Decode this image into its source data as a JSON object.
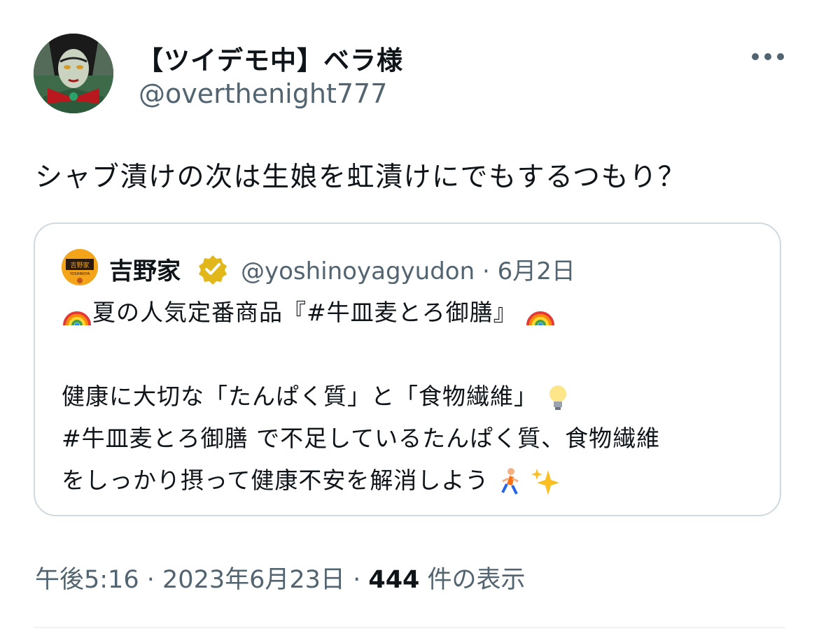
{
  "author": {
    "display_name": "【ツイデモ中】ベラ様",
    "handle": "@overthenight777"
  },
  "tweet_text": "シャブ漬けの次は生娘を虹漬けにでもするつもり？",
  "quoted": {
    "name": "吉野家",
    "handle": "@yoshinoyagyudon",
    "date": "6月2日",
    "line1": "夏の人気定番商品『#牛皿麦とろ御膳』",
    "line2": "健康に大切な「たんぱく質」と「食物繊維」",
    "line3": "#牛皿麦とろ御膳 で不足しているたんぱく質、食物繊維",
    "line4": "をしっかり摂って健康不安を解消しよう",
    "logo_text": "吉野家",
    "logo_sub": "YOSHINOYA",
    "icons": [
      "rainbow-icon",
      "lightbulb-icon",
      "runner-icon",
      "sparkles-icon",
      "verified-badge-icon"
    ]
  },
  "footer": {
    "time": "午後5:16",
    "date": "2023年6月23日",
    "views_count": "444",
    "views_label": "件の表示",
    "separator": "·"
  },
  "colors": {
    "text": "#0f1419",
    "secondary": "#536471",
    "border": "#cfd9de",
    "verified_gold": "#e2b719"
  }
}
